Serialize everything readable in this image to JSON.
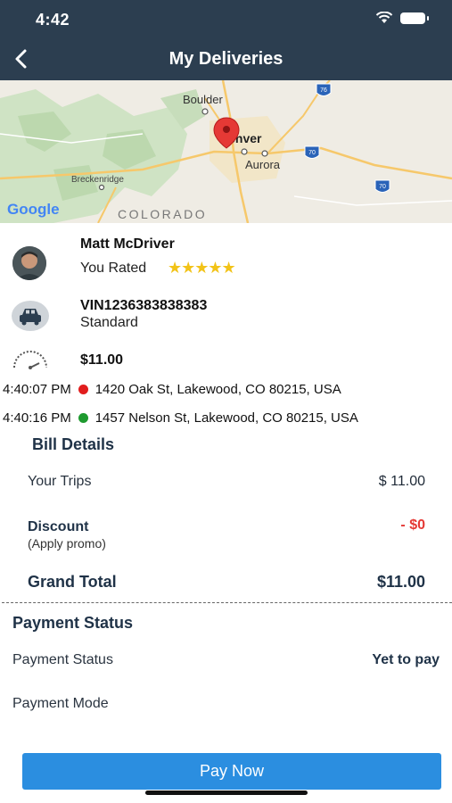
{
  "status_bar": {
    "time": "4:42"
  },
  "header": {
    "title": "My Deliveries"
  },
  "map": {
    "labels": {
      "boulder": "Boulder",
      "denver": "Denver",
      "aurora": "Aurora",
      "breckenridge": "Breckenridge",
      "state": "COLORADO",
      "google": "Google"
    },
    "highways": [
      "76",
      "70",
      "70"
    ]
  },
  "driver": {
    "name": "Matt McDriver",
    "rated_label": "You Rated",
    "stars": "★★★★★",
    "rating": 5
  },
  "vehicle": {
    "vin": "VIN1236383838383",
    "type": "Standard"
  },
  "fare": {
    "amount": "$11.00"
  },
  "trip": {
    "pickup": {
      "time": "4:40:07 PM",
      "address": "1420 Oak St, Lakewood, CO 80215, USA"
    },
    "dropoff": {
      "time": "4:40:16 PM",
      "address": "1457 Nelson St, Lakewood, CO 80215, USA"
    }
  },
  "bill": {
    "title": "Bill Details",
    "trips_label": "Your Trips",
    "trips_value": "$ 11.00",
    "discount_label": "Discount",
    "discount_hint": "(Apply promo)",
    "discount_value": "- $0",
    "grand_total_label": "Grand Total",
    "grand_total_value": "$11.00"
  },
  "payment": {
    "title": "Payment Status",
    "status_label": "Payment Status",
    "status_value": "Yet to pay",
    "mode_label": "Payment Mode"
  },
  "colors": {
    "header": "#2c3e50",
    "pay_button": "#2b8ee0",
    "discount": "#e53935",
    "pickup_dot": "#e11d1d",
    "dropoff_dot": "#1e9a2f",
    "stars": "#f2c318"
  },
  "pay_button_label": "Pay Now"
}
